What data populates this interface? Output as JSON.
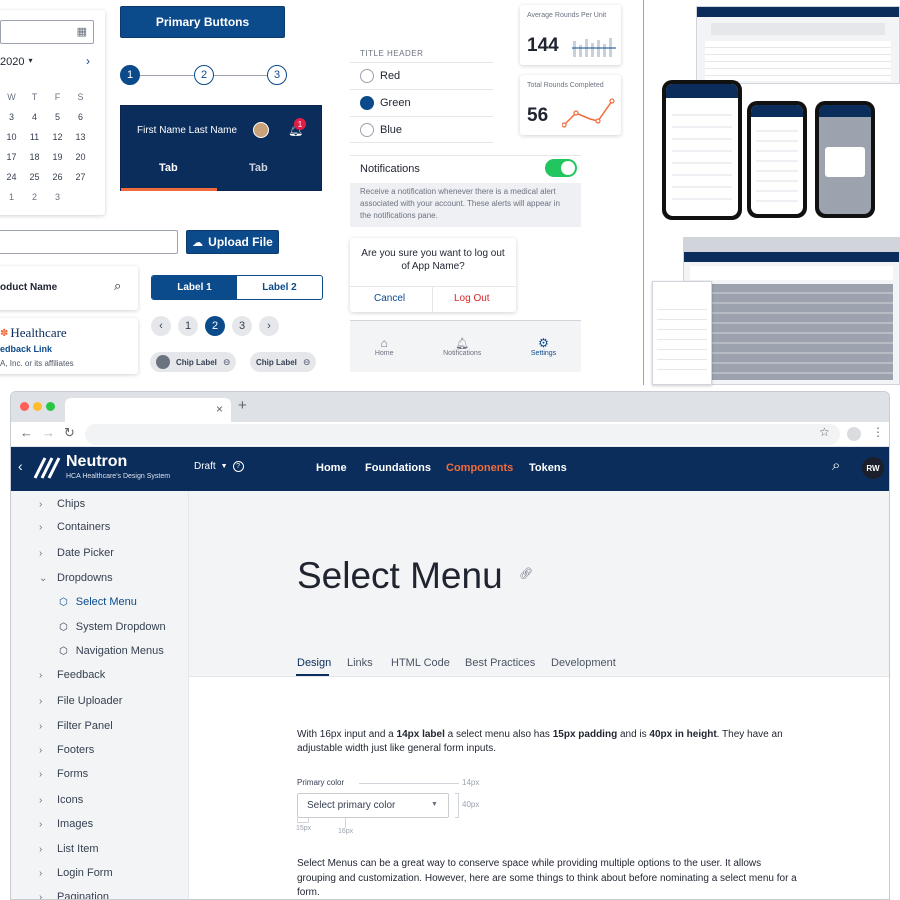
{
  "calendar": {
    "month_label": "2020",
    "days_header": [
      "W",
      "T",
      "F",
      "S"
    ],
    "rows": [
      [
        "3",
        "4",
        "5",
        "6"
      ],
      [
        "10",
        "11",
        "12",
        "13"
      ],
      [
        "17",
        "18",
        "19",
        "20"
      ],
      [
        "24",
        "25",
        "26",
        "27"
      ],
      [
        "1",
        "2",
        "3",
        ""
      ]
    ]
  },
  "primary_button": {
    "label": "Primary Buttons"
  },
  "steps": [
    "1",
    "2",
    "3"
  ],
  "header_card": {
    "name": "First Name Last Name",
    "badge": "1",
    "tab_active": "Tab",
    "tab_other": "Tab"
  },
  "upload": {
    "label": "Upload File"
  },
  "product_search": {
    "label": "oduct Name"
  },
  "segmented": {
    "left": "Label 1",
    "right": "Label 2"
  },
  "footer_brand": {
    "logo": "Healthcare",
    "link": "edback Link",
    "copy": "A, Inc. or its affiliates"
  },
  "pagination": {
    "pages": [
      "1",
      "2",
      "3"
    ]
  },
  "chips": [
    "Chip Label",
    "Chip Label"
  ],
  "radio_group": {
    "title": "TITLE HEADER",
    "options": [
      "Red",
      "Green",
      "Blue"
    ]
  },
  "notifications": {
    "label": "Notifications",
    "description": "Receive a notification whenever there is a medical alert associated with your account. These alerts will appear in the notifications pane."
  },
  "modal": {
    "text": "Are you sure you want to log out of App Name?",
    "cancel": "Cancel",
    "confirm": "Log Out"
  },
  "bottom_nav": {
    "items": [
      "Home",
      "Notifications",
      "Settings"
    ]
  },
  "stats": {
    "avg_label": "Average Rounds Per Unit",
    "avg_value": "144",
    "total_label": "Total Rounds Completed",
    "total_value": "56"
  },
  "browser": {
    "new_tab": "+",
    "close": "×"
  },
  "neutron": {
    "logo": "Neutron",
    "tagline": "HCA Healthcare's Design System",
    "draft": "Draft",
    "nav": [
      "Home",
      "Foundations",
      "Components",
      "Tokens"
    ],
    "avatar": "RW"
  },
  "sidebar": [
    {
      "label": "Chips"
    },
    {
      "label": "Containers"
    },
    {
      "label": "Date Picker"
    },
    {
      "label": "Dropdowns"
    },
    {
      "label": "Select Menu"
    },
    {
      "label": "System Dropdown"
    },
    {
      "label": "Navigation Menus"
    },
    {
      "label": "Feedback"
    },
    {
      "label": "File Uploader"
    },
    {
      "label": "Filter Panel"
    },
    {
      "label": "Footers"
    },
    {
      "label": "Forms"
    },
    {
      "label": "Icons"
    },
    {
      "label": "Images"
    },
    {
      "label": "List Item"
    },
    {
      "label": "Login Form"
    },
    {
      "label": "Pagination"
    }
  ],
  "page": {
    "title": "Select Menu",
    "tabs": [
      "Design",
      "Links",
      "HTML Code",
      "Best Practices",
      "Development"
    ],
    "intro_pre": "With 16px input and a ",
    "intro_b1": "14px label",
    "intro_mid": " a select menu also has ",
    "intro_b2": "15px padding",
    "intro_mid2": " and is ",
    "intro_b3": "40px in height",
    "intro_post": ". They have an adjustable width just like general form inputs.",
    "field_label": "Primary color",
    "field_placeholder": "Select primary color",
    "dim_14": "14px",
    "dim_40": "40px",
    "dim_15": "15px",
    "dim_16": "16px",
    "para2": "Select Menus can be a great way to conserve space while providing multiple options to the user. It allows grouping and customization. However, here are some things to think about before nominating a select menu for a form."
  },
  "colors": {
    "navy": "#0b2d5b",
    "accent_orange": "#f26b3a",
    "primary": "#0b4a8b",
    "toggle_green": "#22c55e"
  }
}
